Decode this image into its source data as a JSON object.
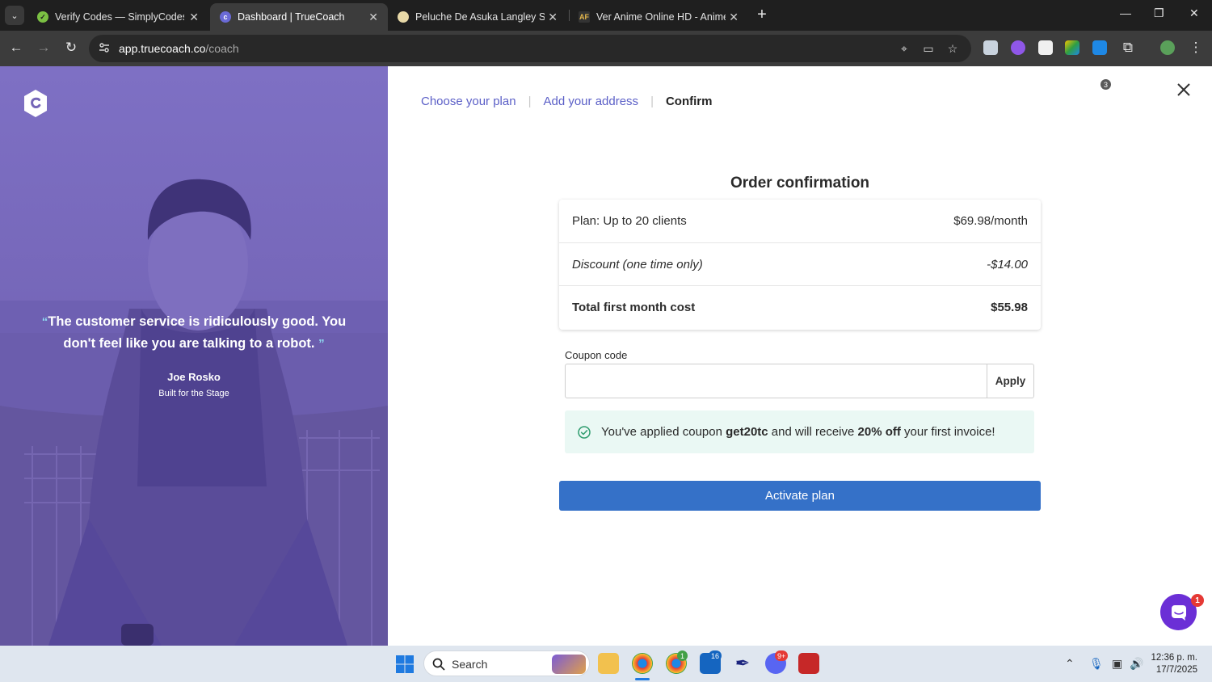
{
  "browser": {
    "tabs": [
      {
        "title": "Verify Codes — SimplyCodes",
        "active": false
      },
      {
        "title": "Dashboard | TrueCoach",
        "active": true
      },
      {
        "title": "Peluche De Asuka Langley Sory",
        "active": false
      },
      {
        "title": "Ver Anime Online HD - AnimeF",
        "active": false
      }
    ],
    "url_host": "app.truecoach.co",
    "url_path": "/coach",
    "extension_badge": "3"
  },
  "promo": {
    "quote": "The customer service is ridiculously good. You don't feel like you are talking to a robot.",
    "author": "Joe Rosko",
    "author_company": "Built for the Stage"
  },
  "steps": [
    {
      "label": "Choose your plan",
      "current": false
    },
    {
      "label": "Add your address",
      "current": false
    },
    {
      "label": "Confirm",
      "current": true
    }
  ],
  "order": {
    "title": "Order confirmation",
    "rows": [
      {
        "label": "Plan: Up to 20 clients",
        "value": "$69.98/month"
      },
      {
        "label": "Discount (one time only)",
        "value": "-$14.00"
      },
      {
        "label": "Total first month cost",
        "value": "$55.98"
      }
    ]
  },
  "coupon": {
    "label": "Coupon code",
    "value": "",
    "placeholder": "",
    "apply_label": "Apply",
    "notice_pre": "You've applied coupon ",
    "notice_code": "get20tc",
    "notice_mid": " and will receive ",
    "notice_discount": "20% off",
    "notice_post": " your first invoice!"
  },
  "activate_label": "Activate plan",
  "chat_badge": "1",
  "taskbar": {
    "search_label": "Search",
    "badges": {
      "chrome_alt": "1",
      "outlook": "16",
      "discord": "9+"
    },
    "time": "12:36 p. m.",
    "date": "17/7/2025"
  },
  "colors": {
    "accent": "#3571c8",
    "step_link": "#5b5fc7",
    "promo_purple": "#7566b8",
    "notice_bg": "#eaf8f4",
    "success": "#2e9c6e"
  }
}
